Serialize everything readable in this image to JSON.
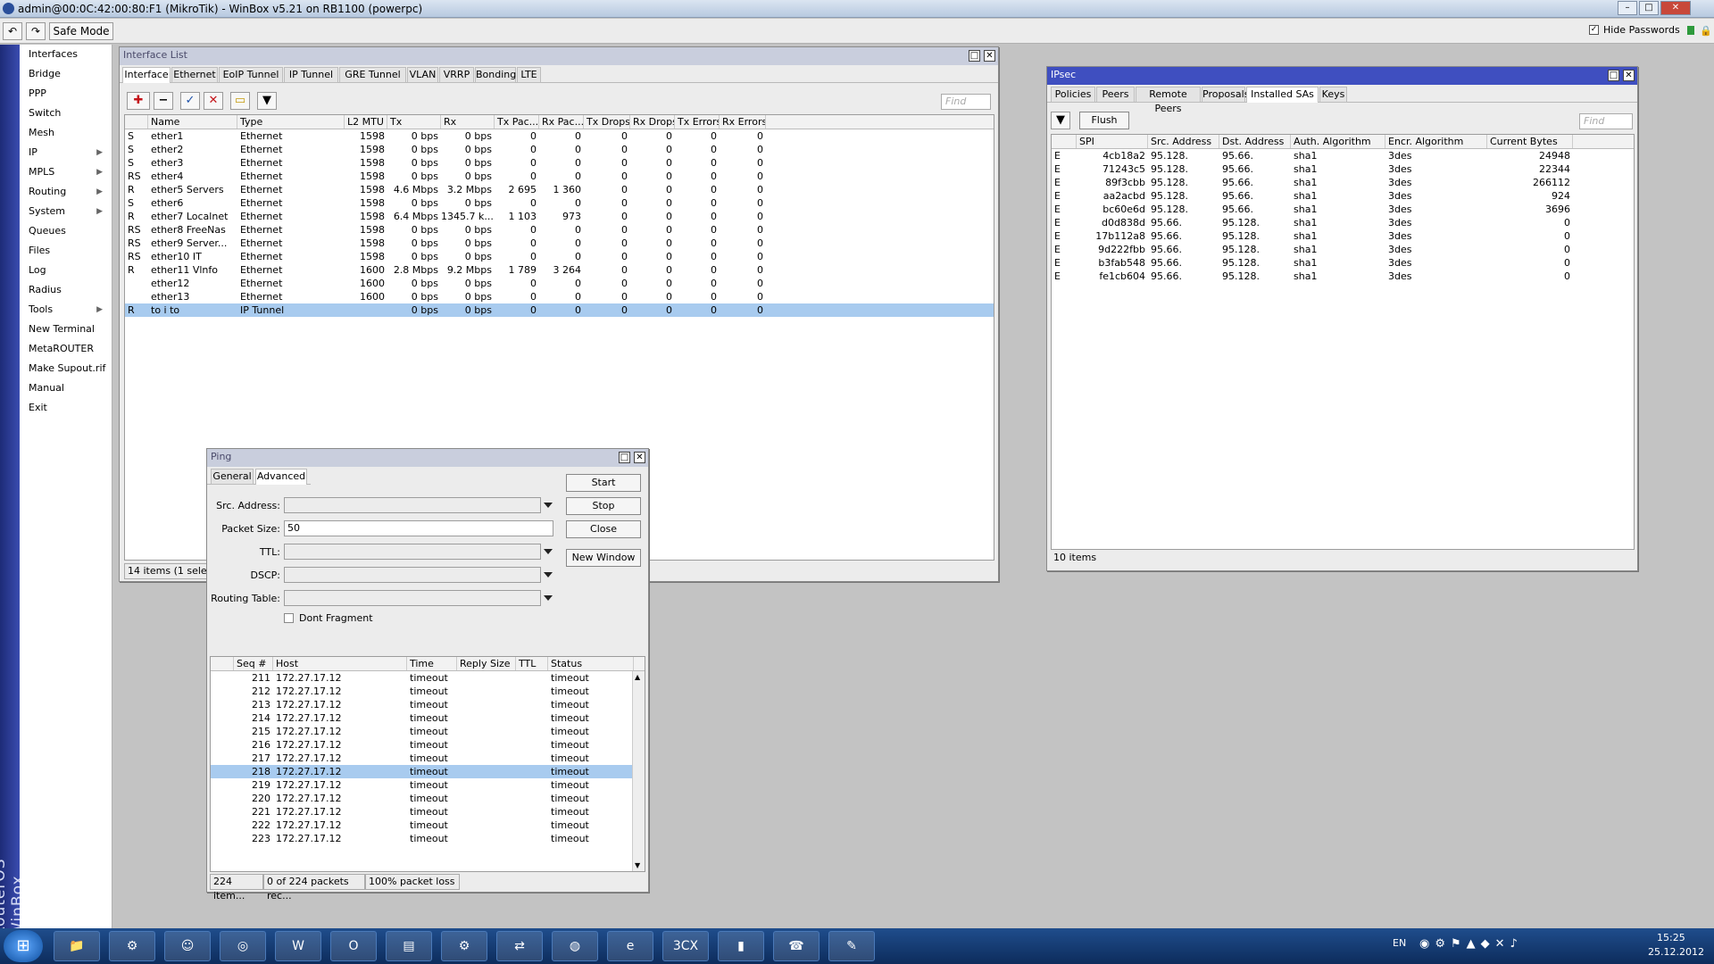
{
  "app": {
    "title": "admin@00:0C:42:00:80:F1 (MikroTik) - WinBox v5.21 on RB1100 (powerpc)",
    "safe_mode": "Safe Mode",
    "hide_passwords": "Hide Passwords",
    "vertical_brand": "RouterOS WinBox"
  },
  "menu": [
    {
      "label": "Interfaces",
      "sub": false
    },
    {
      "label": "Bridge",
      "sub": false
    },
    {
      "label": "PPP",
      "sub": false
    },
    {
      "label": "Switch",
      "sub": false
    },
    {
      "label": "Mesh",
      "sub": false
    },
    {
      "label": "IP",
      "sub": true
    },
    {
      "label": "MPLS",
      "sub": true
    },
    {
      "label": "Routing",
      "sub": true
    },
    {
      "label": "System",
      "sub": true
    },
    {
      "label": "Queues",
      "sub": false
    },
    {
      "label": "Files",
      "sub": false
    },
    {
      "label": "Log",
      "sub": false
    },
    {
      "label": "Radius",
      "sub": false
    },
    {
      "label": "Tools",
      "sub": true
    },
    {
      "label": "New Terminal",
      "sub": false
    },
    {
      "label": "MetaROUTER",
      "sub": false
    },
    {
      "label": "Make Supout.rif",
      "sub": false
    },
    {
      "label": "Manual",
      "sub": false
    },
    {
      "label": "Exit",
      "sub": false
    }
  ],
  "iface": {
    "title": "Interface List",
    "tabs": [
      "Interface",
      "Ethernet",
      "EoIP Tunnel",
      "IP Tunnel",
      "GRE Tunnel",
      "VLAN",
      "VRRP",
      "Bonding",
      "LTE"
    ],
    "find": "Find",
    "columns": [
      "",
      "Name",
      "Type",
      "L2 MTU",
      "Tx",
      "Rx",
      "Tx Pac...",
      "Rx Pac...",
      "Tx Drops",
      "Rx Drops",
      "Tx Errors",
      "Rx Errors"
    ],
    "status": "14 items (1 selected)",
    "rows": [
      [
        "S",
        "ether1",
        "Ethernet",
        "1598",
        "0 bps",
        "0 bps",
        "0",
        "0",
        "0",
        "0",
        "0",
        "0"
      ],
      [
        "S",
        "ether2",
        "Ethernet",
        "1598",
        "0 bps",
        "0 bps",
        "0",
        "0",
        "0",
        "0",
        "0",
        "0"
      ],
      [
        "S",
        "ether3",
        "Ethernet",
        "1598",
        "0 bps",
        "0 bps",
        "0",
        "0",
        "0",
        "0",
        "0",
        "0"
      ],
      [
        "RS",
        "ether4",
        "Ethernet",
        "1598",
        "0 bps",
        "0 bps",
        "0",
        "0",
        "0",
        "0",
        "0",
        "0"
      ],
      [
        "R",
        "ether5 Servers",
        "Ethernet",
        "1598",
        "4.6 Mbps",
        "3.2 Mbps",
        "2 695",
        "1 360",
        "0",
        "0",
        "0",
        "0"
      ],
      [
        "S",
        "ether6",
        "Ethernet",
        "1598",
        "0 bps",
        "0 bps",
        "0",
        "0",
        "0",
        "0",
        "0",
        "0"
      ],
      [
        "R",
        "ether7 Localnet",
        "Ethernet",
        "1598",
        "6.4 Mbps",
        "1345.7 k...",
        "1 103",
        "973",
        "0",
        "0",
        "0",
        "0"
      ],
      [
        "RS",
        "ether8 FreeNas",
        "Ethernet",
        "1598",
        "0 bps",
        "0 bps",
        "0",
        "0",
        "0",
        "0",
        "0",
        "0"
      ],
      [
        "RS",
        "ether9 Server...",
        "Ethernet",
        "1598",
        "0 bps",
        "0 bps",
        "0",
        "0",
        "0",
        "0",
        "0",
        "0"
      ],
      [
        "RS",
        "ether10 IT",
        "Ethernet",
        "1598",
        "0 bps",
        "0 bps",
        "0",
        "0",
        "0",
        "0",
        "0",
        "0"
      ],
      [
        "R",
        "ether11 Vlnfo",
        "Ethernet",
        "1600",
        "2.8 Mbps",
        "9.2 Mbps",
        "1 789",
        "3 264",
        "0",
        "0",
        "0",
        "0"
      ],
      [
        "",
        "ether12",
        "Ethernet",
        "1600",
        "0 bps",
        "0 bps",
        "0",
        "0",
        "0",
        "0",
        "0",
        "0"
      ],
      [
        "",
        "ether13",
        "Ethernet",
        "1600",
        "0 bps",
        "0 bps",
        "0",
        "0",
        "0",
        "0",
        "0",
        "0"
      ],
      [
        "R",
        "to i to",
        "IP Tunnel",
        "",
        "0 bps",
        "0 bps",
        "0",
        "0",
        "0",
        "0",
        "0",
        "0"
      ]
    ]
  },
  "ipsec": {
    "title": "IPsec",
    "tabs": [
      "Policies",
      "Peers",
      "Remote Peers",
      "Proposals",
      "Installed SAs",
      "Keys"
    ],
    "flush": "Flush",
    "find": "Find",
    "columns": [
      "",
      "SPI",
      "Src. Address",
      "Dst. Address",
      "Auth. Algorithm",
      "Encr. Algorithm",
      "Current Bytes"
    ],
    "status": "10 items",
    "rows": [
      [
        "E",
        "4cb18a2",
        "95.128.",
        "95.66.",
        "sha1",
        "3des",
        "24948"
      ],
      [
        "E",
        "71243c5",
        "95.128.",
        "95.66.",
        "sha1",
        "3des",
        "22344"
      ],
      [
        "E",
        "89f3cbb",
        "95.128.",
        "95.66.",
        "sha1",
        "3des",
        "266112"
      ],
      [
        "E",
        "aa2acbd",
        "95.128.",
        "95.66.",
        "sha1",
        "3des",
        "924"
      ],
      [
        "E",
        "bc60e6d",
        "95.128.",
        "95.66.",
        "sha1",
        "3des",
        "3696"
      ],
      [
        "E",
        "d0d838d",
        "95.66.",
        "95.128.",
        "sha1",
        "3des",
        "0"
      ],
      [
        "E",
        "17b112a8",
        "95.66.",
        "95.128.",
        "sha1",
        "3des",
        "0"
      ],
      [
        "E",
        "9d222fbb",
        "95.66.",
        "95.128.",
        "sha1",
        "3des",
        "0"
      ],
      [
        "E",
        "b3fab548",
        "95.66.",
        "95.128.",
        "sha1",
        "3des",
        "0"
      ],
      [
        "E",
        "fe1cb604",
        "95.66.",
        "95.128.",
        "sha1",
        "3des",
        "0"
      ]
    ]
  },
  "ping": {
    "title": "Ping",
    "tabs": [
      "General",
      "Advanced"
    ],
    "fields": {
      "src": "Src. Address:",
      "size": "Packet Size:",
      "size_value": "50",
      "ttl": "TTL:",
      "dscp": "DSCP:",
      "rt": "Routing Table:",
      "df": "Dont Fragment"
    },
    "buttons": {
      "start": "Start",
      "stop": "Stop",
      "close": "Close",
      "new": "New Window"
    },
    "columns": [
      "",
      "Seq #",
      "Host",
      "Time",
      "Reply Size",
      "TTL",
      "Status"
    ],
    "rows": [
      [
        "211",
        "172.27.17.12",
        "timeout",
        "timeout"
      ],
      [
        "212",
        "172.27.17.12",
        "timeout",
        "timeout"
      ],
      [
        "213",
        "172.27.17.12",
        "timeout",
        "timeout"
      ],
      [
        "214",
        "172.27.17.12",
        "timeout",
        "timeout"
      ],
      [
        "215",
        "172.27.17.12",
        "timeout",
        "timeout"
      ],
      [
        "216",
        "172.27.17.12",
        "timeout",
        "timeout"
      ],
      [
        "217",
        "172.27.17.12",
        "timeout",
        "timeout"
      ],
      [
        "218",
        "172.27.17.12",
        "timeout",
        "timeout"
      ],
      [
        "219",
        "172.27.17.12",
        "timeout",
        "timeout"
      ],
      [
        "220",
        "172.27.17.12",
        "timeout",
        "timeout"
      ],
      [
        "221",
        "172.27.17.12",
        "timeout",
        "timeout"
      ],
      [
        "222",
        "172.27.17.12",
        "timeout",
        "timeout"
      ],
      [
        "223",
        "172.27.17.12",
        "timeout",
        "timeout"
      ]
    ],
    "status": [
      "224 item...",
      "0 of 224 packets rec...",
      "100% packet loss"
    ]
  },
  "taskbar": {
    "lang": "EN",
    "time": "15:25",
    "date": "25.12.2012",
    "apps": [
      "folder",
      "winbox",
      "pidgin",
      "chrome",
      "word",
      "outlook",
      "files",
      "winbox2",
      "network",
      "globe",
      "ie",
      "3CX",
      "cmd",
      "phone",
      "notepad"
    ]
  }
}
